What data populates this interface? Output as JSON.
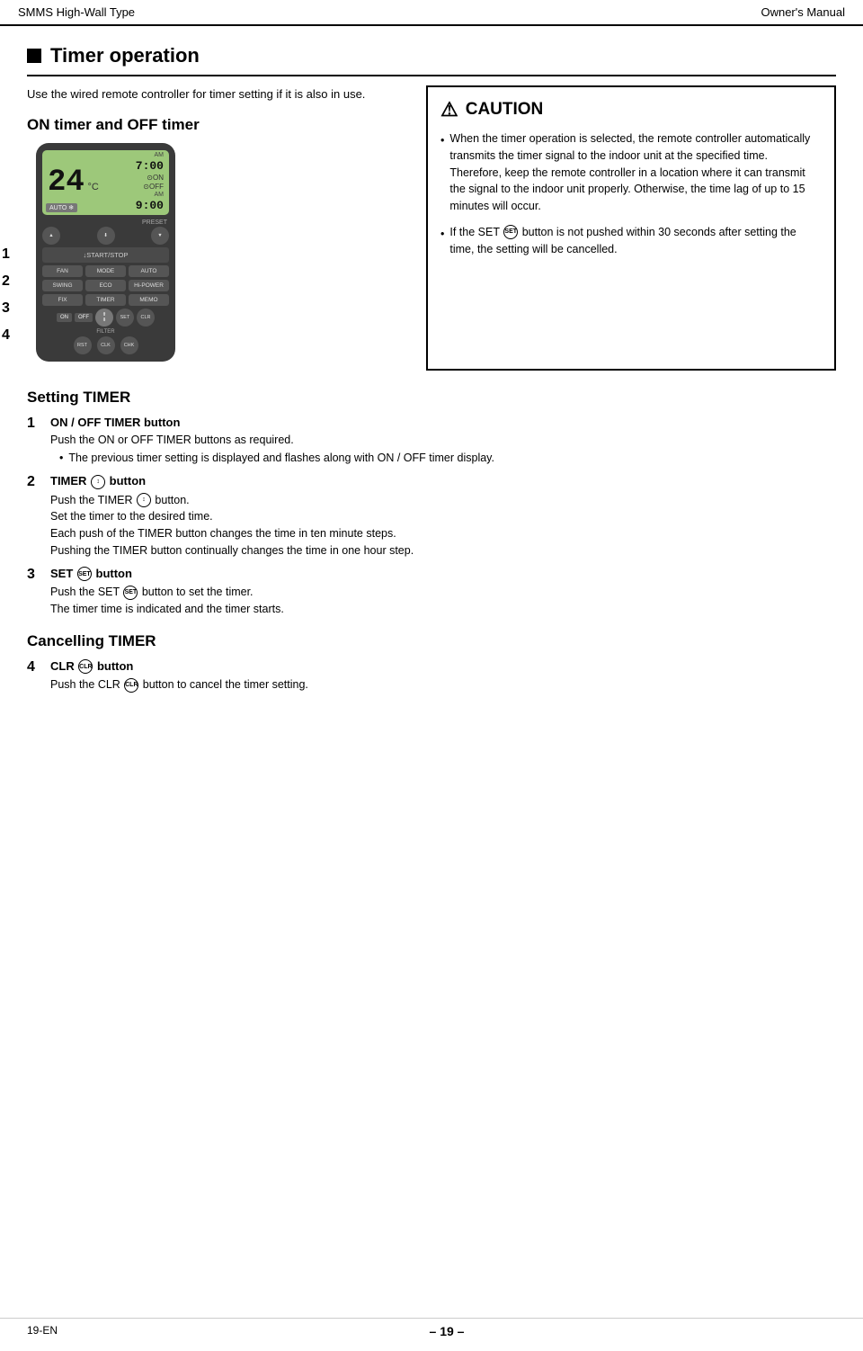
{
  "header": {
    "left": "SMMS High-Wall Type",
    "right": "Owner's Manual"
  },
  "title": "Timer operation",
  "intro": "Use the wired remote controller for timer setting if it is also in use.",
  "on_off_title": "ON timer and OFF timer",
  "caution": {
    "title": "CAUTION",
    "items": [
      "When the timer operation is selected, the remote controller automatically transmits the timer signal to the indoor unit at the specified time. Therefore, keep the remote controller in a location where it can transmit the signal to the indoor unit properly. Otherwise, the time lag of up to 15 minutes will occur.",
      "If the SET  button is not pushed within 30 seconds after setting the time, the setting will be cancelled."
    ]
  },
  "setting_timer": {
    "heading": "Setting TIMER",
    "steps": [
      {
        "num": "1",
        "title": "ON / OFF TIMER button",
        "body": "Push the ON or OFF TIMER buttons as required.",
        "bullets": [
          "The previous timer setting is displayed and flashes along with ON / OFF timer display."
        ]
      },
      {
        "num": "2",
        "title": "TIMER  button",
        "body": "Push the TIMER  button.\nSet the timer to the desired time.\nEach push of the TIMER button changes the time in ten minute steps.\nPushing the TIMER button continually changes the time in one hour step."
      },
      {
        "num": "3",
        "title": "SET  button",
        "body": "Push the SET  button to set the timer.\nThe timer time is indicated and the timer starts."
      }
    ]
  },
  "cancelling_timer": {
    "heading": "Cancelling TIMER",
    "steps": [
      {
        "num": "4",
        "title": "CLR  button",
        "body": "Push the CLR  button to cancel the timer setting."
      }
    ]
  },
  "footer": {
    "left": "19-EN",
    "center": "– 19 –"
  },
  "remote": {
    "temp": "24",
    "unit": "°C",
    "am_label": "AM",
    "time1": "7:00",
    "on_label": "ON",
    "off_label": "OFF",
    "time2": "9:00",
    "mode": "AUTO",
    "buttons": {
      "fan": "FAN",
      "mode": "MODE",
      "auto": "AUTO",
      "swing": "SWING",
      "eco": "ECO",
      "hi_power": "Hi-POWER",
      "fix": "FIX",
      "timer": "TIMER",
      "memo": "MEMO",
      "on": "ON",
      "off": "OFF",
      "set": "SET",
      "clr": "CLR",
      "filter": "FILTER",
      "preset": "PRESET",
      "start_stop": "↓START/STOP",
      "reset": "RESET",
      "clock": "CLOCK",
      "check": "CHECK"
    }
  },
  "side_labels": [
    "1",
    "2",
    "3",
    "4"
  ]
}
